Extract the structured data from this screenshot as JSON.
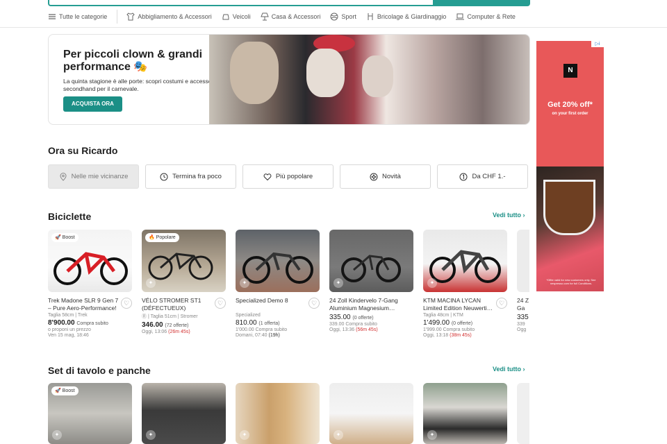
{
  "categories": {
    "all": "Tutte le categorie",
    "items": [
      "Abbigliamento & Accessori",
      "Veicoli",
      "Casa & Accessori",
      "Sport",
      "Bricolage & Giardinaggio",
      "Computer & Rete"
    ]
  },
  "hero": {
    "title": "Per piccoli clown & grandi performance 🎭",
    "subtitle": "La quinta stagione è alle porte: scopri costumi e accessori secondhand per il carnevale.",
    "cta": "ACQUISTA ORA"
  },
  "ad": {
    "logo": "N",
    "headline": "Get 20% off*",
    "tagline": "on your first order",
    "fine_print": "*Offer valid for new customers only. See nespresso.com for full Conditions."
  },
  "now": {
    "title": "Ora su Ricardo",
    "filters": [
      "Nelle mie vicinanze",
      "Termina fra poco",
      "Più popolare",
      "Novità",
      "Da CHF 1.-"
    ]
  },
  "bikes": {
    "title": "Biciclette",
    "see_all": "Vedi tutto",
    "cards": [
      {
        "badge": "Boost",
        "title": "Trek Madone SLR 9 Gen 7 – Pure Aero-Performance!",
        "meta": "Taglia 58cm | Trek",
        "price": "8'900.00",
        "price_note": "Compra subito",
        "line1": "o proponi un prezzo",
        "line2": "Ven 15 mag, 18:46",
        "countdown": ""
      },
      {
        "badge": "Popolare",
        "title": "VÉLO STROMER ST1 (DÉFECTUEUX)",
        "meta": "Ⓡ | Taglia 51cm | Stromer",
        "price": "346.00",
        "price_note": "(72 offerte)",
        "line1": "",
        "line2": "Oggi, 13:06 ",
        "countdown": "(26m 45s)"
      },
      {
        "badge": "",
        "title": "Specialized Demo 8",
        "meta": "Specialized",
        "price": "810.00",
        "price_note": "(1 offerta)",
        "line1": "1'000.00 Compra subito",
        "line2": "Domani, 07:40 ",
        "countdown": "(19h)"
      },
      {
        "badge": "",
        "title": "24 Zoll Kindervelo 7-Gang Aluminium Magnesium…",
        "meta": "",
        "price": "335.00",
        "price_note": "(0 offerte)",
        "line1": "339.00 Compra subito",
        "line2": "Oggi, 13:36 ",
        "countdown": "(56m 45s)"
      },
      {
        "badge": "",
        "title": "KTM MACINA LYCAN Limited Edition Neuwerti…",
        "meta": "Taglia 48cm | KTM",
        "price": "1'499.00",
        "price_note": "(0 offerte)",
        "line1": "1'999.00 Compra subito",
        "line2": "Oggi, 13:18 ",
        "countdown": "(38m 45s)"
      },
      {
        "badge": "",
        "title": "24 Z 7-Ga",
        "meta": "",
        "price": "335",
        "price_note": "",
        "line1": "339",
        "line2": "Ogg",
        "countdown": ""
      }
    ]
  },
  "tables": {
    "title": "Set di tavolo e panche",
    "see_all": "Vedi tutto",
    "cards": [
      {
        "badge": "Boost"
      },
      {
        "badge": ""
      },
      {
        "badge": ""
      },
      {
        "badge": ""
      },
      {
        "badge": ""
      },
      {
        "badge": ""
      }
    ]
  },
  "colors": {
    "accent": "#1b8f86",
    "ad_red": "#e85859",
    "countdown_red": "#d23030"
  }
}
